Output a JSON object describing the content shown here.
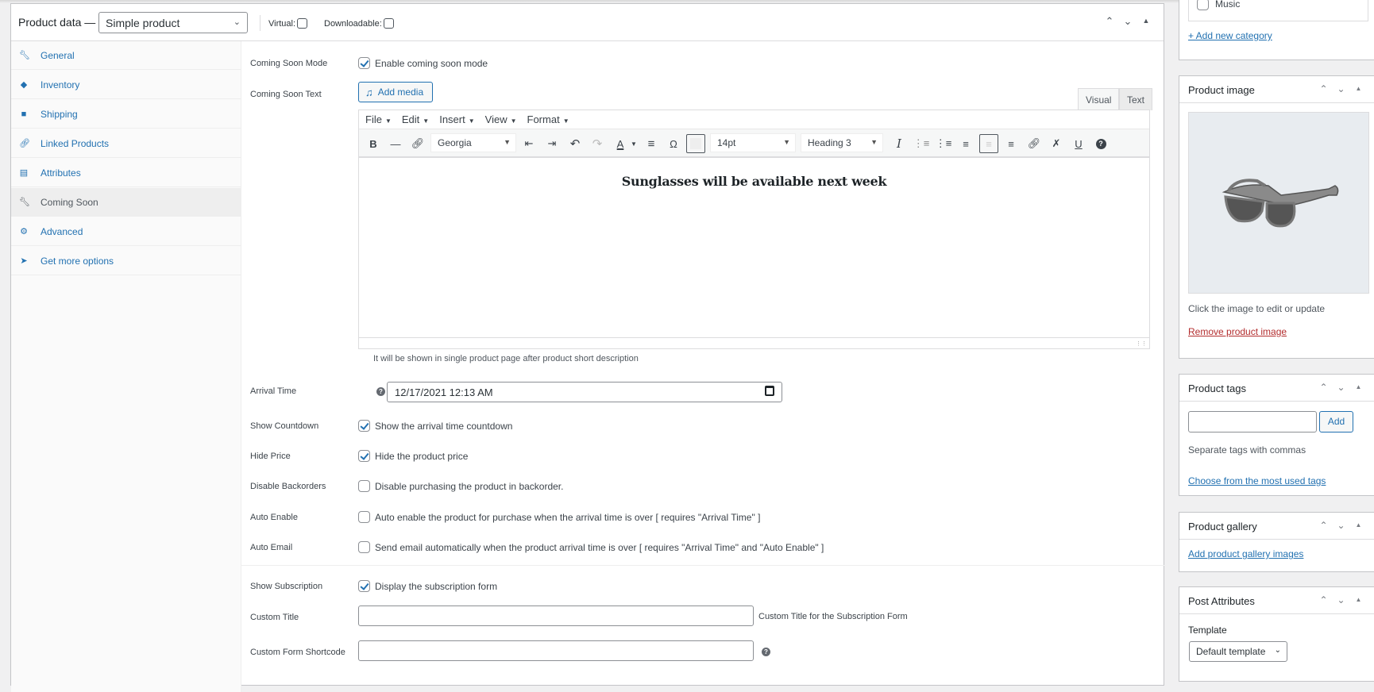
{
  "product_data": {
    "title": "Product data —",
    "product_type": "Simple product",
    "virtual_label": "Virtual:",
    "virtual_checked": false,
    "downloadable_label": "Downloadable:",
    "downloadable_checked": false,
    "header_controls": [
      "move-up-icon",
      "move-down-icon",
      "toggle-panel-icon"
    ]
  },
  "tabs": [
    {
      "label": "General",
      "icon": "wrench-icon"
    },
    {
      "label": "Inventory",
      "icon": "tag-icon"
    },
    {
      "label": "Shipping",
      "icon": "truck-icon"
    },
    {
      "label": "Linked Products",
      "icon": "link-icon"
    },
    {
      "label": "Attributes",
      "icon": "list-icon"
    },
    {
      "label": "Coming Soon",
      "icon": "wrench-icon",
      "active": true
    },
    {
      "label": "Advanced",
      "icon": "gear-icon"
    },
    {
      "label": "Get more options",
      "icon": "plugin-icon"
    }
  ],
  "fields": {
    "coming_soon_mode": {
      "label": "Coming Soon Mode",
      "checkbox_label": "Enable coming soon mode",
      "checked": true
    },
    "coming_soon_text": {
      "label": "Coming Soon Text"
    },
    "arrival_time": {
      "label": "Arrival Time",
      "value": "12/17/2021 12:13  AM"
    },
    "show_countdown": {
      "label": "Show Countdown",
      "checkbox_label": "Show the arrival time countdown",
      "checked": true
    },
    "hide_price": {
      "label": "Hide Price",
      "checkbox_label": "Hide the product price",
      "checked": true
    },
    "disable_backorders": {
      "label": "Disable Backorders",
      "checkbox_label": "Disable purchasing the product in backorder.",
      "checked": false
    },
    "auto_enable": {
      "label": "Auto Enable",
      "checkbox_label": "Auto enable the product for purchase when the arrival time is over [ requires \"Arrival Time\" ]",
      "checked": false
    },
    "auto_email": {
      "label": "Auto Email",
      "checkbox_label": "Send email automatically when the product arrival time is over [ requires \"Arrival Time\" and \"Auto Enable\" ]",
      "checked": false
    },
    "show_subscription": {
      "label": "Show Subscription",
      "checkbox_label": "Display the subscription form",
      "checked": true
    },
    "custom_title": {
      "label": "Custom Title",
      "value": "",
      "hint": "Custom Title for the Subscription Form"
    },
    "custom_form_shortcode": {
      "label": "Custom Form Shortcode",
      "value": ""
    }
  },
  "editor": {
    "add_media_label": "Add media",
    "tab_visual": "Visual",
    "tab_text": "Text",
    "menu": [
      "File",
      "Edit",
      "Insert",
      "View",
      "Format"
    ],
    "font_family": "Georgia",
    "font_size": "14pt",
    "block_format": "Heading 3",
    "content": "Sunglasses will be available next week",
    "hint": "It will be shown in single product page after product short description"
  },
  "sidebar": {
    "categories": {
      "items": [
        {
          "label": "Music",
          "checked": false
        }
      ],
      "add_link": "+ Add new category"
    },
    "product_image": {
      "title": "Product image",
      "hint": "Click the image to edit or update",
      "remove_link": "Remove product image"
    },
    "product_tags": {
      "title": "Product tags",
      "input_value": "",
      "add_label": "Add",
      "hint": "Separate tags with commas",
      "choose_link": "Choose from the most used tags"
    },
    "product_gallery": {
      "title": "Product gallery",
      "add_link": "Add product gallery images"
    },
    "post_attributes": {
      "title": "Post Attributes",
      "template_label": "Template",
      "template_value": "Default template"
    }
  }
}
